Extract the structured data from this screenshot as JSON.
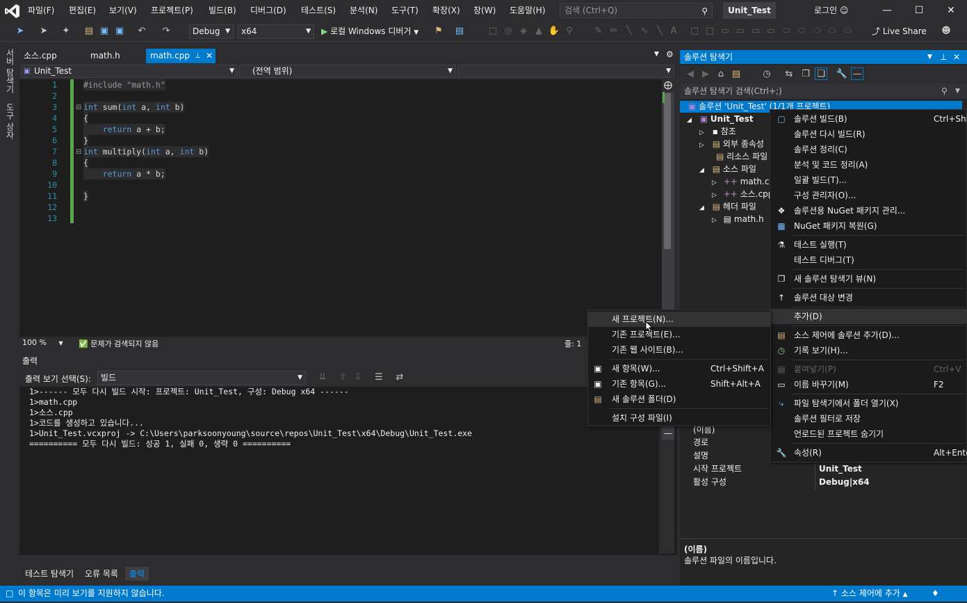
{
  "menubar": {
    "items": [
      "파일(F)",
      "편집(E)",
      "보기(V)",
      "프로젝트(P)",
      "빌드(B)",
      "디버그(D)",
      "테스트(S)",
      "분석(N)",
      "도구(T)",
      "확장(X)",
      "창(W)",
      "도움말(H)"
    ],
    "search_placeholder": "검색 (Ctrl+Q)",
    "solution_title": "Unit_Test",
    "login": "로그인"
  },
  "toolbar": {
    "config": "Debug",
    "platform": "x64",
    "run_label": "로컬 Windows 디버거",
    "liveshare": "Live Share"
  },
  "sidebar": {
    "server_explorer": "서버 탐색기",
    "toolbox": "도구 상자"
  },
  "doc_tabs": [
    {
      "label": "소스.cpp",
      "active": false
    },
    {
      "label": "math.h",
      "active": false
    },
    {
      "label": "math.cpp",
      "active": true
    }
  ],
  "nav": {
    "project": "Unit_Test",
    "scope": "(전역 범위)"
  },
  "editor": {
    "line_numbers": [
      "1",
      "2",
      "3",
      "4",
      "5",
      "6",
      "7",
      "8",
      "9",
      "10",
      "11",
      "12",
      "13"
    ],
    "lines": [
      "#include \"math.h\"",
      "",
      "int sum(int a, int b)",
      "{",
      "    return a + b;",
      "}",
      "int multiply(int a, int b)",
      "{",
      "    return a * b;",
      "",
      "}",
      "",
      ""
    ],
    "zoom": "100 %",
    "issues": "문제가 검색되지 않음",
    "line_label": "줄: 1"
  },
  "output": {
    "title": "출력",
    "show_from_label": "출력 보기 선택(S):",
    "source": "빌드",
    "lines": [
      "1>------ 모두 다시 빌드 시작: 프로젝트: Unit_Test, 구성: Debug x64 ------",
      "1>math.cpp",
      "1>소스.cpp",
      "1>코드를 생성하고 있습니다...",
      "1>Unit_Test.vcxproj -> C:\\Users\\parksoonyoung\\source\\repos\\Unit_Test\\x64\\Debug\\Unit_Test.exe",
      "========== 모두 다시 빌드: 성공 1, 실패 0, 생략 0 =========="
    ],
    "bottom_tabs": [
      "테스트 탐색기",
      "오류 목록",
      "출력"
    ]
  },
  "solution_explorer": {
    "title": "솔루션 탐색기",
    "search_placeholder": "솔루션 탐색기 검색(Ctrl+;)",
    "solution_node": "솔루션 'Unit_Test' (1/1개 프로젝트)",
    "project": "Unit_Test",
    "nodes": [
      "참조",
      "외부 종속성",
      "리소스 파일",
      "소스 파일",
      "math.cpp",
      "소스.cpp",
      "헤더 파일",
      "math.h"
    ]
  },
  "properties": {
    "rows": [
      {
        "name": "(이름)",
        "value": ""
      },
      {
        "name": "경로",
        "value": ""
      },
      {
        "name": "설명",
        "value": ""
      },
      {
        "name": "시작 프로젝트",
        "value": "Unit_Test"
      },
      {
        "name": "활성 구성",
        "value": "Debug|x64"
      }
    ],
    "desc_title": "(이름)",
    "desc_text": "솔루션 파일의 이름입니다."
  },
  "context_menu": {
    "items": [
      {
        "label": "솔루션 빌드(B)",
        "shortcut": "Ctrl+Shift+B",
        "icon": "build-icon"
      },
      {
        "label": "솔루션 다시 빌드(R)",
        "shortcut": "",
        "icon": ""
      },
      {
        "label": "솔루션 정리(C)",
        "shortcut": "",
        "icon": ""
      },
      {
        "label": "분석 및 코드 정리(A)",
        "shortcut": "",
        "icon": ""
      },
      {
        "label": "일괄 빌드(T)...",
        "shortcut": "",
        "icon": ""
      },
      {
        "label": "구성 관리자(O)...",
        "shortcut": "",
        "icon": ""
      },
      {
        "label": "솔루션용 NuGet 패키지 관리...",
        "shortcut": "",
        "icon": "nuget-icon"
      },
      {
        "label": "NuGet 패키지 복원(G)",
        "shortcut": "",
        "icon": "nuget-restore-icon"
      },
      {
        "label": "테스트 실행(T)",
        "shortcut": "",
        "icon": "flask-icon"
      },
      {
        "label": "테스트 디버그(T)",
        "shortcut": "",
        "icon": ""
      },
      {
        "label": "새 솔루션 탐색기 뷰(N)",
        "shortcut": "",
        "icon": "new-view-icon"
      },
      {
        "label": "솔루션 대상 변경",
        "shortcut": "",
        "icon": "arrow-up-icon"
      },
      {
        "label": "추가(D)",
        "shortcut": "",
        "icon": ""
      },
      {
        "label": "소스 제어에 솔루션 추가(D)...",
        "shortcut": "",
        "icon": "source-control-icon"
      },
      {
        "label": "기록 보기(H)...",
        "shortcut": "",
        "icon": "history-icon"
      },
      {
        "label": "붙여넣기(P)",
        "shortcut": "Ctrl+V",
        "icon": "paste-icon"
      },
      {
        "label": "이름 바꾸기(M)",
        "shortcut": "F2",
        "icon": "rename-icon"
      },
      {
        "label": "파일 탐색기에서 폴더 열기(X)",
        "shortcut": "",
        "icon": "open-folder-icon"
      },
      {
        "label": "솔루션 필터로 저장",
        "shortcut": "",
        "icon": ""
      },
      {
        "label": "언로드된 프로젝트 숨기기",
        "shortcut": "",
        "icon": ""
      },
      {
        "label": "속성(R)",
        "shortcut": "Alt+Enter",
        "icon": "wrench-icon"
      }
    ]
  },
  "submenu": {
    "items": [
      {
        "label": "새 프로젝트(N)...",
        "shortcut": ""
      },
      {
        "label": "기존 프로젝트(E)...",
        "shortcut": ""
      },
      {
        "label": "기존 웹 사이트(B)...",
        "shortcut": ""
      },
      {
        "label": "새 항목(W)...",
        "shortcut": "Ctrl+Shift+A"
      },
      {
        "label": "기존 항목(G)...",
        "shortcut": "Shift+Alt+A"
      },
      {
        "label": "새 솔루션 폴더(D)",
        "shortcut": ""
      },
      {
        "label": "설치 구성 파일(I)",
        "shortcut": ""
      }
    ]
  },
  "statusbar": {
    "message": "이 항목은 미리 보기를 지원하지 않습니다.",
    "source_control": "소스 제어에 추가"
  }
}
